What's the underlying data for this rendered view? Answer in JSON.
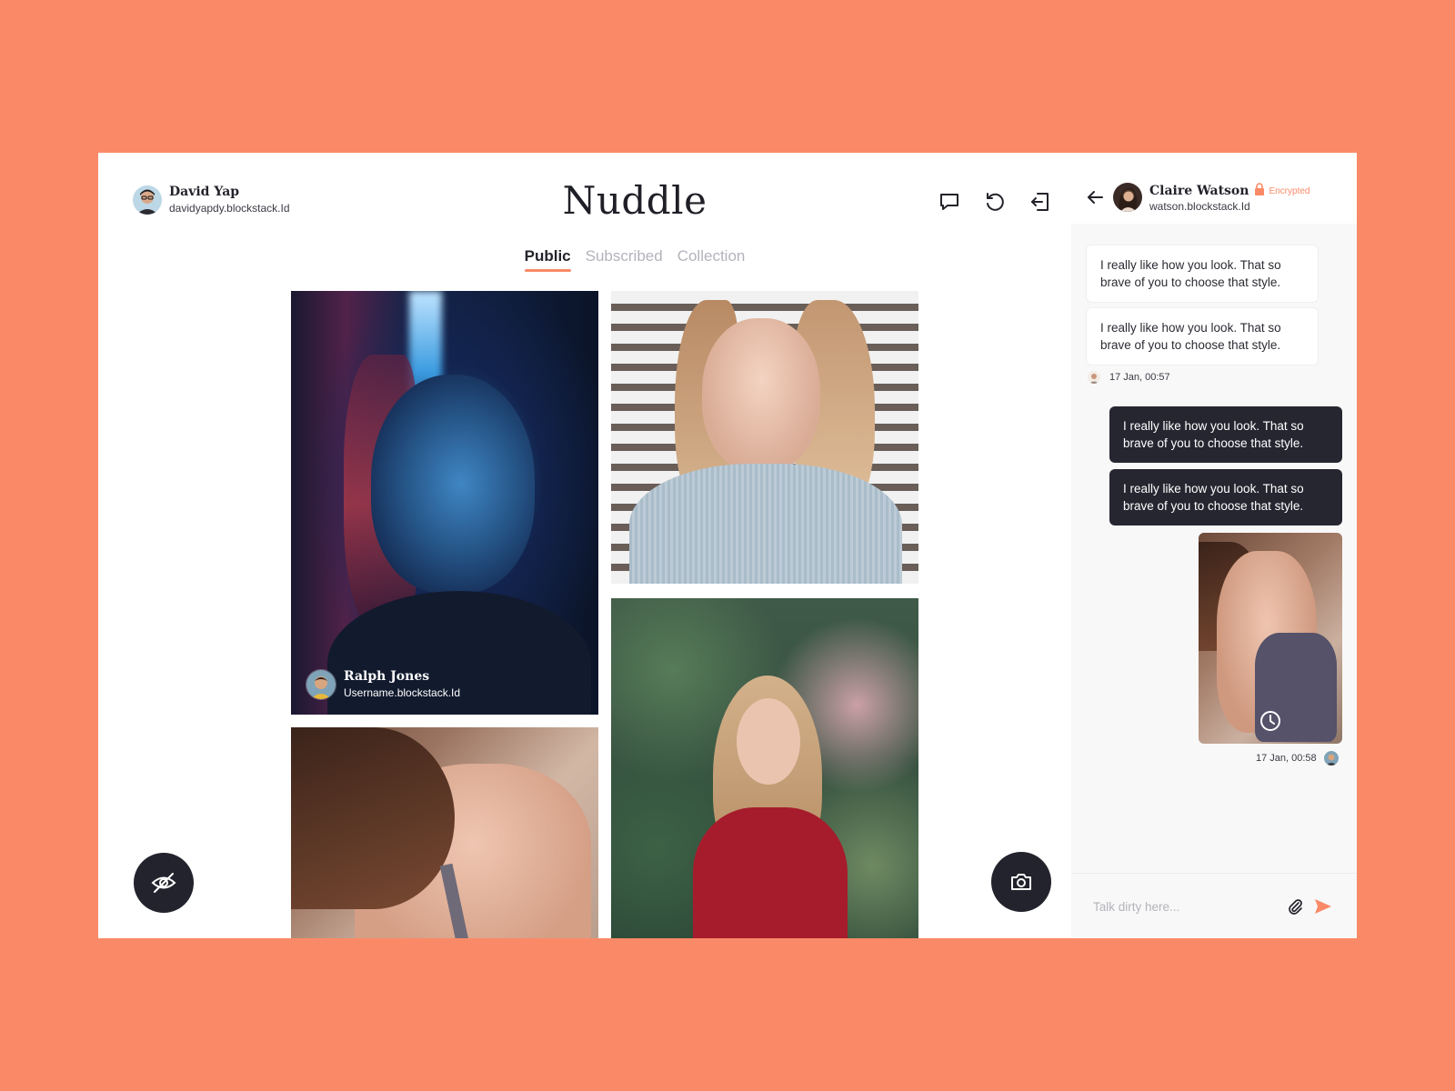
{
  "user": {
    "name": "David Yap",
    "handle": "davidyapdy.blockstack.Id"
  },
  "app": {
    "title": "Nuddle"
  },
  "toolbar": {
    "icons": [
      "chat-bubble-icon",
      "refresh-icon",
      "logout-icon"
    ]
  },
  "tabs": [
    {
      "label": "Public",
      "active": true
    },
    {
      "label": "Subscribed",
      "active": false
    },
    {
      "label": "Collection",
      "active": false
    }
  ],
  "feed": {
    "credit": {
      "name": "Ralph Jones",
      "handle": "Username.blockstack.Id"
    }
  },
  "fabs": {
    "left_icon": "eye-off-icon",
    "right_icon": "camera-icon"
  },
  "chat": {
    "contact": {
      "name": "Claire Watson",
      "status": "Encrypted",
      "handle": "watson.blockstack.Id"
    },
    "messages": [
      {
        "direction": "in",
        "text": "I really like how you look. That so brave of you to choose that style."
      },
      {
        "direction": "in",
        "text": "I really like how you look. That so brave of you to choose that style."
      },
      {
        "direction": "out",
        "text": "I really like how you look. That so brave of you to choose that style."
      },
      {
        "direction": "out",
        "text": "I really like how you look. That so brave of you to choose that style."
      }
    ],
    "time_in": "17 Jan, 00:57",
    "time_out": "17 Jan, 00:58",
    "input_placeholder": "Talk dirty here..."
  },
  "colors": {
    "background": "#fa8a67",
    "accent": "#fa8a67",
    "dark": "#262631"
  }
}
